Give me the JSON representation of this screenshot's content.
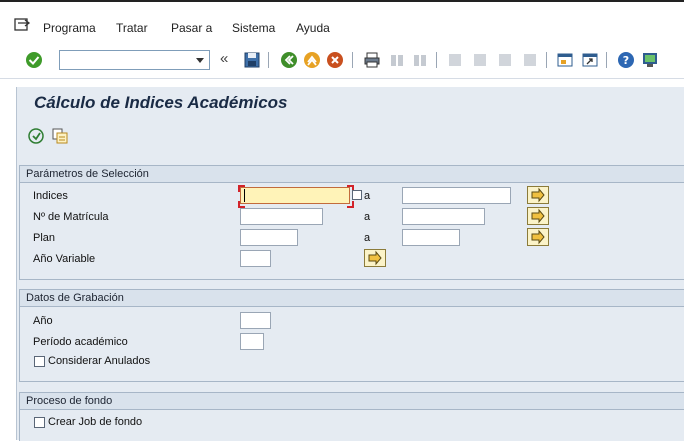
{
  "menu": {
    "items": [
      {
        "label": "Programa"
      },
      {
        "label": "Tratar"
      },
      {
        "label": "Pasar a"
      },
      {
        "label": "Sistema"
      },
      {
        "label": "Ayuda"
      }
    ]
  },
  "toolbar": {
    "command_field_value": ""
  },
  "page": {
    "title": "Cálculo de Indices Académicos"
  },
  "groups": {
    "selection": {
      "header": "Parámetros de Selección",
      "rows": [
        {
          "label": "Indices",
          "to_label": "a"
        },
        {
          "label": "Nº de Matrícula",
          "to_label": "a"
        },
        {
          "label": "Plan",
          "to_label": "a"
        },
        {
          "label": "Año Variable"
        }
      ]
    },
    "recording": {
      "header": "Datos de Grabación",
      "year_label": "Año",
      "period_label": "Período académico",
      "annulled_label": "Considerar Anulados"
    },
    "background": {
      "header": "Proceso de fondo",
      "job_label": "Crear Job de fondo"
    }
  }
}
